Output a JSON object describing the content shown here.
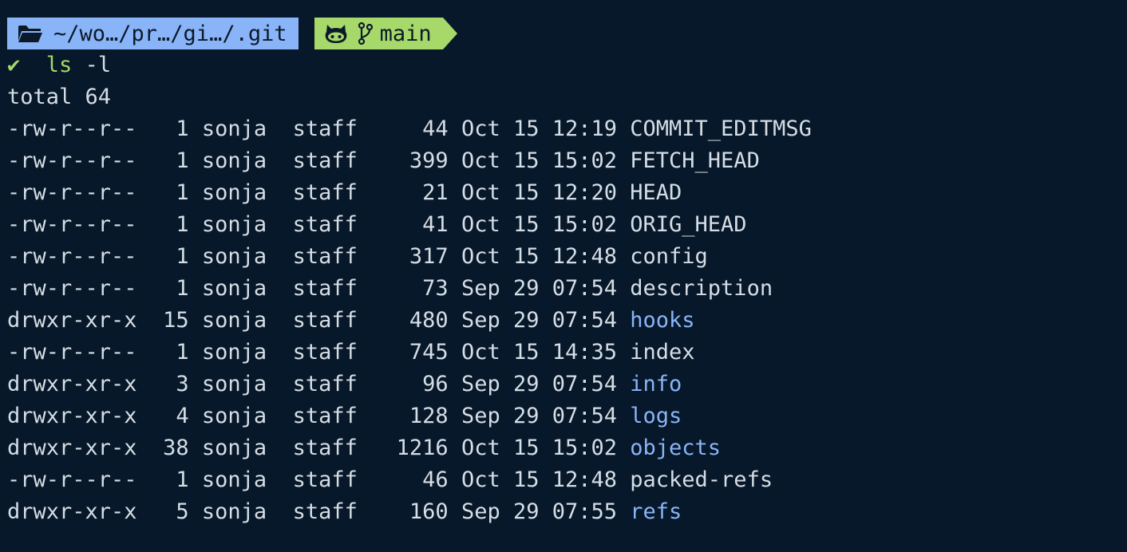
{
  "prompt": {
    "path": "~/wo…/pr…/gi…/.git",
    "branch": "main",
    "status_icon": "✔",
    "command": "ls",
    "args": "-l",
    "icons": {
      "folder": "folder-open-icon",
      "github": "github-icon",
      "branch": "git-branch-icon"
    },
    "colors": {
      "path_bg": "#8ab4f8",
      "git_bg": "#a6d86a",
      "background": "#061829"
    }
  },
  "output": {
    "total": "total 64",
    "entries": [
      {
        "perms": "-rw-r--r--",
        "links": "1",
        "owner": "sonja",
        "group": "staff",
        "size": "44",
        "month": "Oct",
        "day": "15",
        "time": "12:19",
        "name": "COMMIT_EDITMSG",
        "is_dir": false
      },
      {
        "perms": "-rw-r--r--",
        "links": "1",
        "owner": "sonja",
        "group": "staff",
        "size": "399",
        "month": "Oct",
        "day": "15",
        "time": "15:02",
        "name": "FETCH_HEAD",
        "is_dir": false
      },
      {
        "perms": "-rw-r--r--",
        "links": "1",
        "owner": "sonja",
        "group": "staff",
        "size": "21",
        "month": "Oct",
        "day": "15",
        "time": "12:20",
        "name": "HEAD",
        "is_dir": false
      },
      {
        "perms": "-rw-r--r--",
        "links": "1",
        "owner": "sonja",
        "group": "staff",
        "size": "41",
        "month": "Oct",
        "day": "15",
        "time": "15:02",
        "name": "ORIG_HEAD",
        "is_dir": false
      },
      {
        "perms": "-rw-r--r--",
        "links": "1",
        "owner": "sonja",
        "group": "staff",
        "size": "317",
        "month": "Oct",
        "day": "15",
        "time": "12:48",
        "name": "config",
        "is_dir": false
      },
      {
        "perms": "-rw-r--r--",
        "links": "1",
        "owner": "sonja",
        "group": "staff",
        "size": "73",
        "month": "Sep",
        "day": "29",
        "time": "07:54",
        "name": "description",
        "is_dir": false
      },
      {
        "perms": "drwxr-xr-x",
        "links": "15",
        "owner": "sonja",
        "group": "staff",
        "size": "480",
        "month": "Sep",
        "day": "29",
        "time": "07:54",
        "name": "hooks",
        "is_dir": true
      },
      {
        "perms": "-rw-r--r--",
        "links": "1",
        "owner": "sonja",
        "group": "staff",
        "size": "745",
        "month": "Oct",
        "day": "15",
        "time": "14:35",
        "name": "index",
        "is_dir": false
      },
      {
        "perms": "drwxr-xr-x",
        "links": "3",
        "owner": "sonja",
        "group": "staff",
        "size": "96",
        "month": "Sep",
        "day": "29",
        "time": "07:54",
        "name": "info",
        "is_dir": true
      },
      {
        "perms": "drwxr-xr-x",
        "links": "4",
        "owner": "sonja",
        "group": "staff",
        "size": "128",
        "month": "Sep",
        "day": "29",
        "time": "07:54",
        "name": "logs",
        "is_dir": true
      },
      {
        "perms": "drwxr-xr-x",
        "links": "38",
        "owner": "sonja",
        "group": "staff",
        "size": "1216",
        "month": "Oct",
        "day": "15",
        "time": "15:02",
        "name": "objects",
        "is_dir": true
      },
      {
        "perms": "-rw-r--r--",
        "links": "1",
        "owner": "sonja",
        "group": "staff",
        "size": "46",
        "month": "Oct",
        "day": "15",
        "time": "12:48",
        "name": "packed-refs",
        "is_dir": false
      },
      {
        "perms": "drwxr-xr-x",
        "links": "5",
        "owner": "sonja",
        "group": "staff",
        "size": "160",
        "month": "Sep",
        "day": "29",
        "time": "07:55",
        "name": "refs",
        "is_dir": true
      }
    ]
  }
}
